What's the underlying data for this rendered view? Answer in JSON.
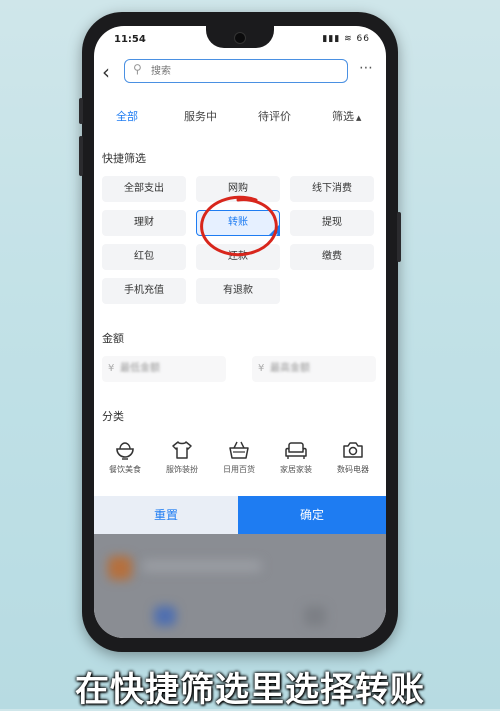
{
  "status_bar": {
    "time": "11:54",
    "icons": "▮▮▮ ≋ 66"
  },
  "search": {
    "placeholder": "搜索"
  },
  "tabs": [
    {
      "label": "全部",
      "active": true
    },
    {
      "label": "服务中",
      "active": false
    },
    {
      "label": "待评价",
      "active": false
    },
    {
      "label": "筛选",
      "active": false
    }
  ],
  "quick_filter": {
    "title": "快捷筛选",
    "chips": [
      "全部支出",
      "网购",
      "线下消费",
      "理财",
      "转账",
      "提现",
      "红包",
      "还款",
      "缴费",
      "手机充值",
      "有退款"
    ],
    "selected": "转账"
  },
  "amount": {
    "title": "金额",
    "currency": "¥",
    "min_placeholder": "最低金额",
    "max_placeholder": "最高金额"
  },
  "category": {
    "title": "分类",
    "items": [
      {
        "label": "餐饮美食",
        "icon": "bowl-icon"
      },
      {
        "label": "服饰装扮",
        "icon": "shirt-icon"
      },
      {
        "label": "日用百货",
        "icon": "basket-icon"
      },
      {
        "label": "家居家装",
        "icon": "sofa-icon"
      },
      {
        "label": "数码电器",
        "icon": "camera-icon"
      }
    ]
  },
  "footer": {
    "reset": "重置",
    "confirm": "确定"
  },
  "caption": "在快捷筛选里选择转账",
  "colors": {
    "accent": "#1e7cf2",
    "annotation": "#d8261c"
  }
}
